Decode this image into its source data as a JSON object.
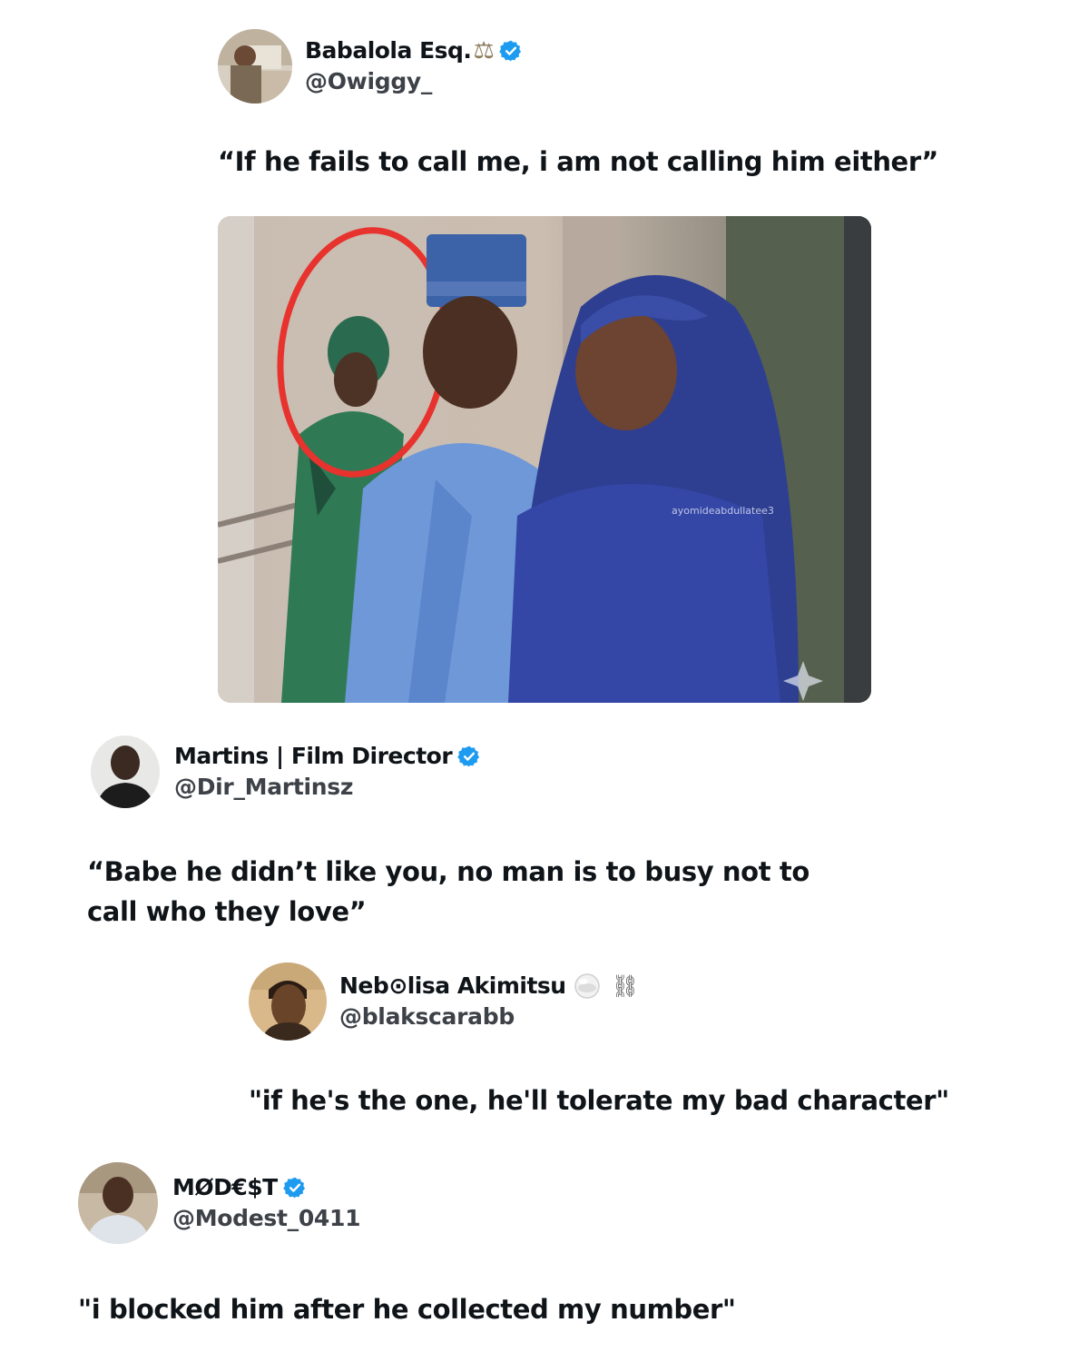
{
  "tweets": [
    {
      "display_name": "Babalola Esq.",
      "badge_emoji": "⚖",
      "verified": true,
      "handle": "@Owiggy_",
      "text": "“If he fails to call me, i am not calling him either”",
      "media_watermark": "ayomideabdullatee3"
    },
    {
      "display_name": "Martins | Film Director",
      "verified": true,
      "handle": "@Dir_Martinsz",
      "text_line1": "“Babe he didn’t like you, no man is to busy not to",
      "text_line2": "call who they love”"
    },
    {
      "display_name": "Neb⊙lisa Akimitsu",
      "badge_emoji": "⛓",
      "verified": false,
      "handle": "@blakscarabb",
      "text": "\"if he's the one, he'll tolerate my bad character\""
    },
    {
      "display_name": "MØD€$T",
      "verified": true,
      "handle": "@Modest_0411",
      "text": "\"i blocked him after he collected my number\""
    }
  ],
  "colors": {
    "verified_blue": "#1d9bf0",
    "text": "#0f1419",
    "handle": "#3d4248",
    "highlight_circle": "#e8322d"
  }
}
